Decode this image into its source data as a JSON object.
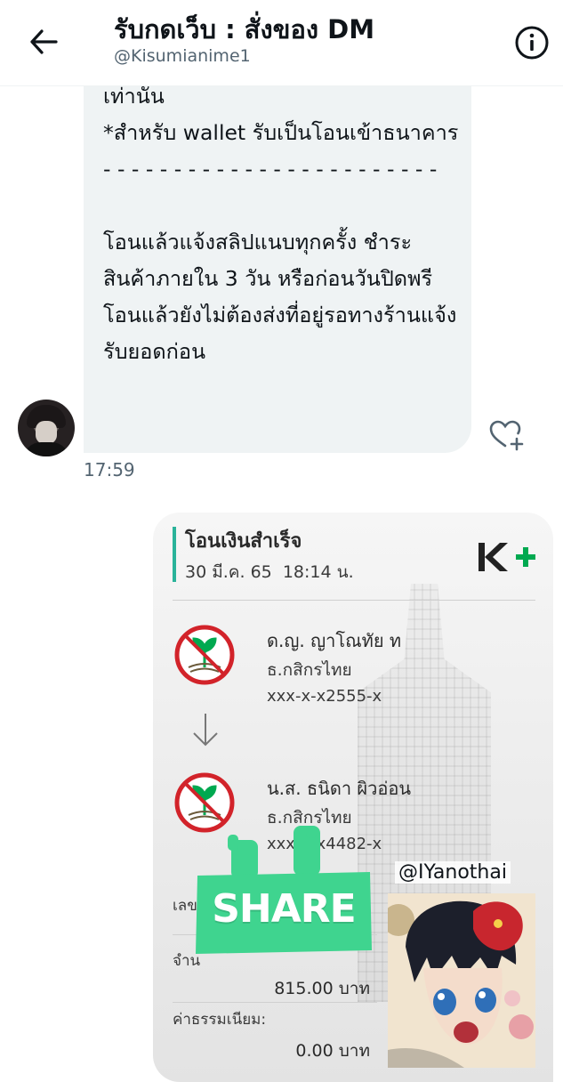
{
  "header": {
    "title": "รับกดเว็บ : สั่งของ DM",
    "handle": "@Kisumianime1"
  },
  "incoming_message": {
    "text": "เท่านั้น\n*สำหรับ wallet รับเป็นโอนเข้าธนาคาร\n- - - - - - - - - - - - - - - - - - - - - - - -\n\nโอนแล้วแจ้งสลิปแนบทุกครั้ง ชำระสินค้าภายใน 3 วัน หรือก่อนวันปิดพรี\nโอนแล้วยังไม่ต้องส่งที่อยู่รอทางร้านแจ้งรับยอดก่อน",
    "time": "17:59"
  },
  "transfer_slip": {
    "status": "โอนเงินสำเร็จ",
    "date": "30 มี.ค. 65  18:14 น.",
    "brand": "K+",
    "from": {
      "name": "ด.ญ. ญาโณทัย ท",
      "bank": "ธ.กสิกรไทย",
      "account": "xxx-x-x2555-x"
    },
    "to": {
      "name": "น.ส. ธนิดา ผิวอ่อน",
      "bank": "ธ.กสิกรไทย",
      "account": "xxx-x-x4482-x"
    },
    "ref_label": "เลข",
    "amount_label": "จำน",
    "amount": "815.00 บาท",
    "fee_label": "ค่าธรรมเนียม:",
    "fee": "0.00 บาท"
  },
  "overlays": {
    "share_text": "SHARE",
    "watermark": "@IYanothai"
  },
  "colors": {
    "kbank_green": "#00a950",
    "accent_teal": "#2ab39a",
    "sticker_green": "#3fd48f"
  }
}
